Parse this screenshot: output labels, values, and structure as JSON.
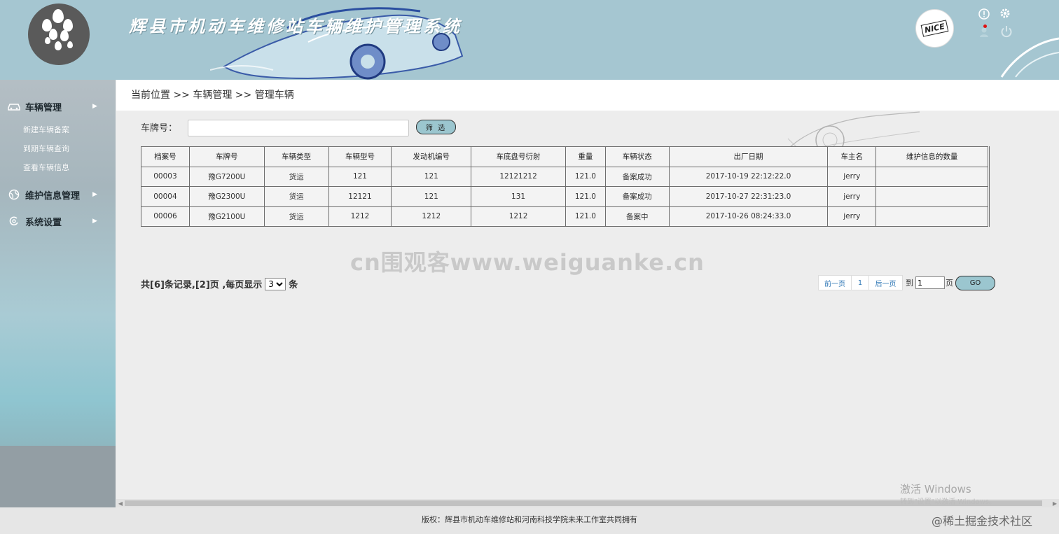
{
  "header": {
    "title": "辉县市机动车维修站车辆维护管理系统",
    "avatar_text": "NICE",
    "icons": [
      "info-icon",
      "gear-icon",
      "user-icon",
      "power-icon"
    ]
  },
  "sidebar": {
    "groups": [
      {
        "label": "车辆管理",
        "icon": "car-icon",
        "items": [
          "新建车辆备案",
          "到期车辆查询",
          "查看车辆信息"
        ]
      },
      {
        "label": "维护信息管理",
        "icon": "globe-icon",
        "items": []
      },
      {
        "label": "系统设置",
        "icon": "settings-icon",
        "items": []
      }
    ]
  },
  "breadcrumb": "当前位置 >> 车辆管理 >> 管理车辆",
  "filter": {
    "label": "车牌号：",
    "value": "",
    "placeholder": "",
    "button": "筛 选"
  },
  "table": {
    "headers": [
      "档案号",
      "车牌号",
      "车辆类型",
      "车辆型号",
      "发动机编号",
      "车底盘号衍射",
      "重量",
      "车辆状态",
      "出厂日期",
      "车主名",
      "维护信息的数量"
    ],
    "rows": [
      [
        "00003",
        "豫G7200U",
        "货运",
        "121",
        "121",
        "12121212",
        "121.0",
        "备案成功",
        "2017-10-19 22:12:22.0",
        "jerry",
        ""
      ],
      [
        "00004",
        "豫G2300U",
        "货运",
        "12121",
        "121",
        "131",
        "121.0",
        "备案成功",
        "2017-10-27 22:31:23.0",
        "jerry",
        ""
      ],
      [
        "00006",
        "豫G2100U",
        "货运",
        "1212",
        "1212",
        "1212",
        "121.0",
        "备案中",
        "2017-10-26 08:24:33.0",
        "jerry",
        ""
      ]
    ]
  },
  "watermark": "cn围观客www.weiguanke.cn",
  "pagination": {
    "summary_prefix": "共[6]条记录,[2]页 ,每页显示",
    "page_size": "3",
    "summary_suffix": "条",
    "prev": "前一页",
    "current": "1",
    "next": "后一页",
    "jump_prefix": "到",
    "jump_value": "1",
    "jump_suffix": "页",
    "go": "GO"
  },
  "windows_activation": {
    "title": "激活 Windows",
    "subtitle": "转到\"设置\"以激活 Windows。"
  },
  "footer": {
    "copyright": "版权：辉县市机动车维修站和河南科技学院未来工作室共同拥有",
    "community": "@稀土掘金技术社区"
  },
  "colors": {
    "header_bg": "#a5c6d1",
    "button_bg": "#9bc6cf",
    "page_bg": "#ededed"
  }
}
